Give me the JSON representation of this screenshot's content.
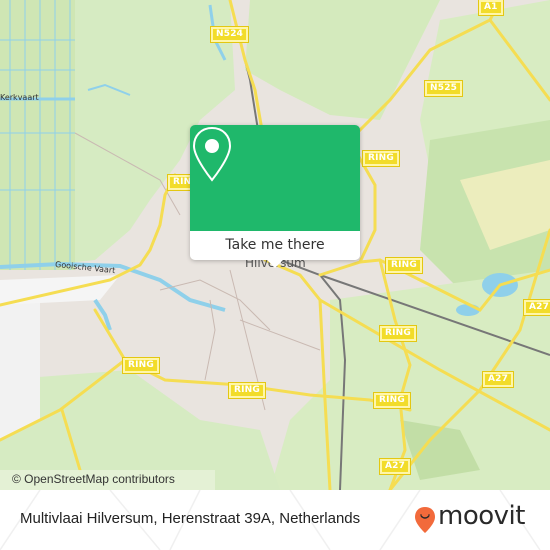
{
  "map": {
    "attribution": "© OpenStreetMap contributors",
    "city_label": "Hilversum",
    "water_labels": [
      "Kerkvaart",
      "Gooische Vaart"
    ],
    "road_shields": [
      "N524",
      "A1",
      "N525",
      "RING",
      "RING",
      "RING",
      "RING",
      "RING",
      "RING",
      "RING",
      "RING",
      "A27",
      "A27",
      "A27"
    ],
    "colors": {
      "urban": "#e9e4df",
      "park": "#d8ecc0",
      "forest": "#c6e2aa",
      "water": "#8fd0ea",
      "road": "#f5dd52",
      "rail": "#777777"
    }
  },
  "popup": {
    "button_label": "Take me there",
    "icon": "map-pin-icon",
    "color": "#1fb86b"
  },
  "footer": {
    "address": "Multivlaai Hilversum, Herenstraat 39A, Netherlands",
    "brand": "moovit",
    "brand_color": "#f26a3b"
  }
}
